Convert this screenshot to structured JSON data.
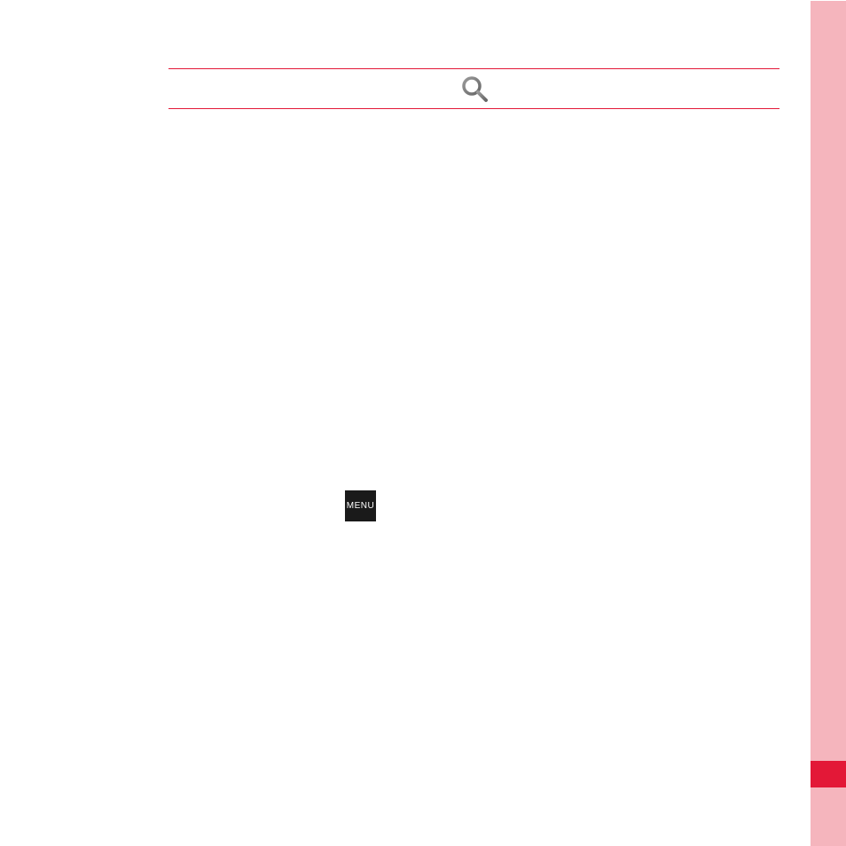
{
  "menu": {
    "label": "MENU"
  },
  "colors": {
    "accent": "#e31837",
    "sidebar": "#f5b5bd",
    "menuBg": "#1a1a1a"
  }
}
